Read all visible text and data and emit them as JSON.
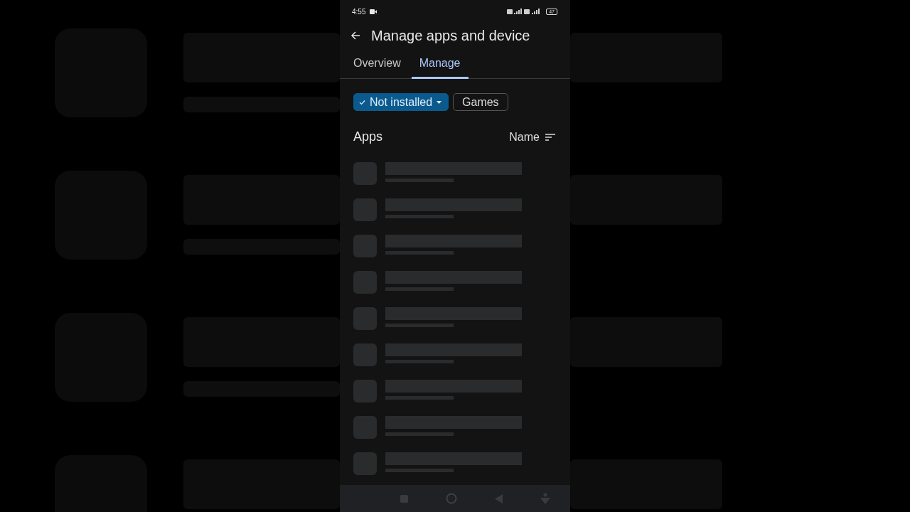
{
  "status_bar": {
    "time": "4:55",
    "battery": "47"
  },
  "app_bar": {
    "title": "Manage apps and device"
  },
  "tabs": [
    {
      "label": "Overview",
      "selected": false
    },
    {
      "label": "Manage",
      "selected": true
    }
  ],
  "filters": [
    {
      "label": "Not installed",
      "selected": true,
      "dropdown": true
    },
    {
      "label": "Games",
      "selected": false,
      "dropdown": false
    }
  ],
  "section": {
    "title": "Apps",
    "sort_label": "Name"
  }
}
